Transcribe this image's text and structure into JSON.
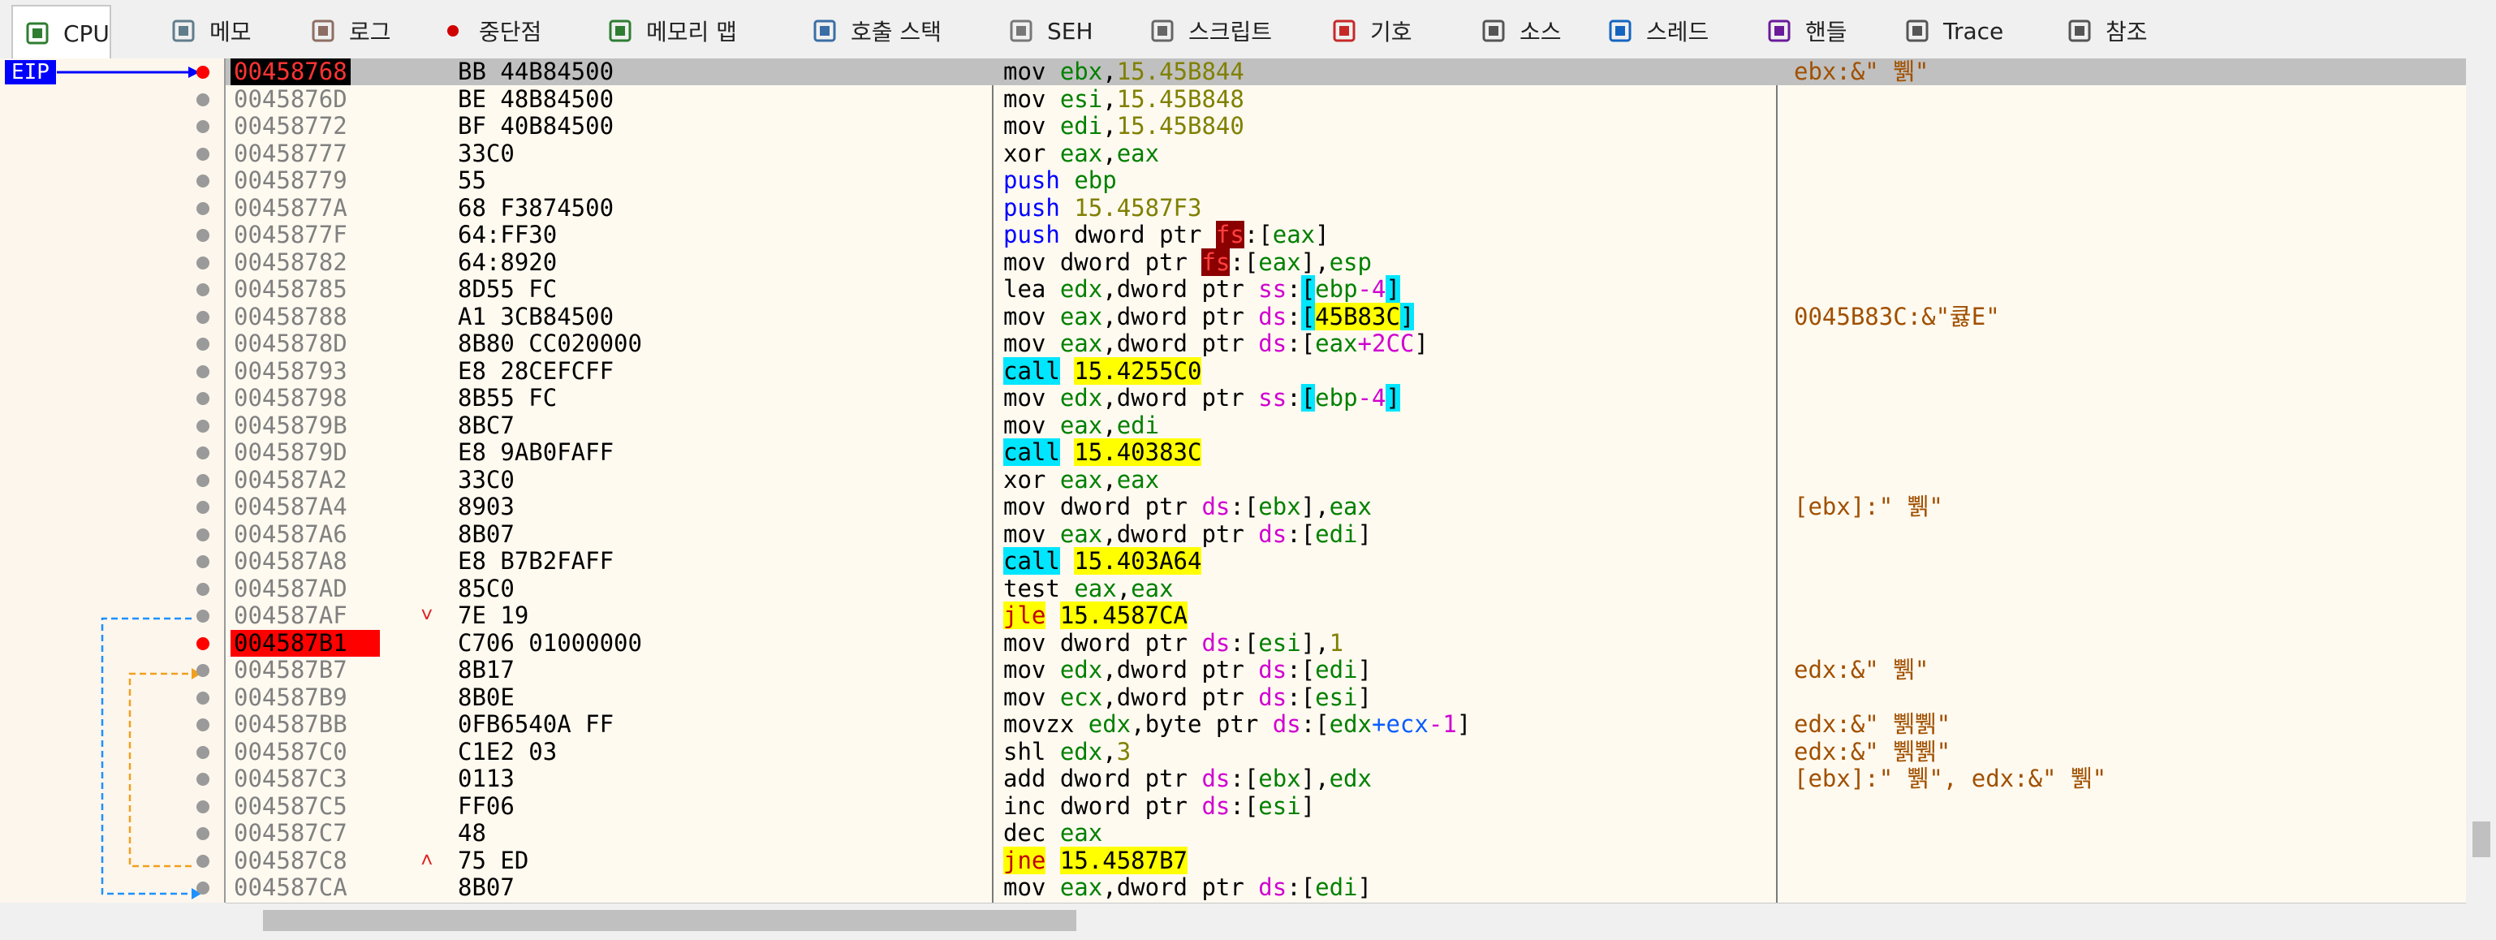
{
  "tabs": [
    {
      "label": "CPU",
      "icon": "cpu-icon",
      "active": true
    },
    {
      "label": "메모",
      "icon": "notes-icon"
    },
    {
      "label": "로그",
      "icon": "log-icon"
    },
    {
      "label": "중단점",
      "icon": "breakpoint-icon"
    },
    {
      "label": "메모리 맵",
      "icon": "memory-map-icon"
    },
    {
      "label": "호출 스택",
      "icon": "call-stack-icon"
    },
    {
      "label": "SEH",
      "icon": "seh-icon"
    },
    {
      "label": "스크립트",
      "icon": "script-icon"
    },
    {
      "label": "기호",
      "icon": "symbols-icon"
    },
    {
      "label": "소스",
      "icon": "source-icon"
    },
    {
      "label": "스레드",
      "icon": "threads-icon"
    },
    {
      "label": "핸들",
      "icon": "handles-icon"
    },
    {
      "label": "Trace",
      "icon": "trace-icon"
    },
    {
      "label": "참조",
      "icon": "references-icon"
    }
  ],
  "eip_label": "EIP",
  "rows": [
    {
      "addr": "00458768",
      "bytes": "BB 44B84500",
      "dis": [
        [
          "mn",
          "mov "
        ],
        [
          "reg",
          "ebx"
        ],
        [
          "",
          ","
        ],
        [
          "num",
          "15.45B844"
        ]
      ],
      "cmt": "ebx:&\" 쀍\"",
      "state": "eip"
    },
    {
      "addr": "0045876D",
      "bytes": "BE 48B84500",
      "dis": [
        [
          "mn",
          "mov "
        ],
        [
          "reg",
          "esi"
        ],
        [
          "",
          ","
        ],
        [
          "num",
          "15.45B848"
        ]
      ],
      "cmt": ""
    },
    {
      "addr": "00458772",
      "bytes": "BF 40B84500",
      "dis": [
        [
          "mn",
          "mov "
        ],
        [
          "reg",
          "edi"
        ],
        [
          "",
          ","
        ],
        [
          "num",
          "15.45B840"
        ]
      ],
      "cmt": ""
    },
    {
      "addr": "00458777",
      "bytes": "33C0",
      "dis": [
        [
          "mn",
          "xor "
        ],
        [
          "reg",
          "eax"
        ],
        [
          "",
          ","
        ],
        [
          "reg",
          "eax"
        ]
      ],
      "cmt": ""
    },
    {
      "addr": "00458779",
      "bytes": "55",
      "dis": [
        [
          "push",
          "push "
        ],
        [
          "reg",
          "ebp"
        ]
      ],
      "cmt": ""
    },
    {
      "addr": "0045877A",
      "bytes": "68 F3874500",
      "dis": [
        [
          "push",
          "push "
        ],
        [
          "num",
          "15.4587F3"
        ]
      ],
      "cmt": ""
    },
    {
      "addr": "0045877F",
      "bytes": "64:FF30",
      "dis": [
        [
          "push",
          "push "
        ],
        [
          "mn",
          "dword ptr "
        ],
        [
          "fs",
          "fs"
        ],
        [
          "",
          ":["
        ],
        [
          "reg",
          "eax"
        ],
        [
          "",
          "]"
        ]
      ],
      "cmt": ""
    },
    {
      "addr": "00458782",
      "bytes": "64:8920",
      "dis": [
        [
          "mn",
          "mov dword ptr "
        ],
        [
          "fs",
          "fs"
        ],
        [
          "",
          ":["
        ],
        [
          "reg",
          "eax"
        ],
        [
          "",
          "],"
        ],
        [
          "reg",
          "esp"
        ]
      ],
      "cmt": ""
    },
    {
      "addr": "00458785",
      "bytes": "8D55 FC",
      "dis": [
        [
          "mn",
          "lea "
        ],
        [
          "reg",
          "edx"
        ],
        [
          "",
          ",dword ptr "
        ],
        [
          "seg",
          "ss"
        ],
        [
          "",
          ":"
        ],
        [
          "brk",
          "["
        ],
        [
          "reg",
          "ebp"
        ],
        [
          "seg",
          "-4"
        ],
        [
          "brk",
          "]"
        ]
      ],
      "cmt": ""
    },
    {
      "addr": "00458788",
      "bytes": "A1 3CB84500",
      "dis": [
        [
          "mn",
          "mov "
        ],
        [
          "reg",
          "eax"
        ],
        [
          "",
          ",dword ptr "
        ],
        [
          "seg",
          "ds"
        ],
        [
          "",
          ":"
        ],
        [
          "brk",
          "["
        ],
        [
          "tgt",
          "45B83C"
        ],
        [
          "brk",
          "]"
        ]
      ],
      "cmt": "0045B83C:&\"큟E\""
    },
    {
      "addr": "0045878D",
      "bytes": "8B80 CC020000",
      "dis": [
        [
          "mn",
          "mov "
        ],
        [
          "reg",
          "eax"
        ],
        [
          "",
          ",dword ptr "
        ],
        [
          "seg",
          "ds"
        ],
        [
          "",
          ":["
        ],
        [
          "reg",
          "eax"
        ],
        [
          "seg",
          "+2CC"
        ],
        [
          "",
          "]"
        ]
      ],
      "cmt": ""
    },
    {
      "addr": "00458793",
      "bytes": "E8 28CEFCFF",
      "dis": [
        [
          "call",
          "call"
        ],
        [
          "",
          " "
        ],
        [
          "tgt",
          "15.4255C0"
        ]
      ],
      "cmt": ""
    },
    {
      "addr": "00458798",
      "bytes": "8B55 FC",
      "dis": [
        [
          "mn",
          "mov "
        ],
        [
          "reg",
          "edx"
        ],
        [
          "",
          ",dword ptr "
        ],
        [
          "seg",
          "ss"
        ],
        [
          "",
          ":"
        ],
        [
          "brk",
          "["
        ],
        [
          "reg",
          "ebp"
        ],
        [
          "seg",
          "-4"
        ],
        [
          "brk",
          "]"
        ]
      ],
      "cmt": ""
    },
    {
      "addr": "0045879B",
      "bytes": "8BC7",
      "dis": [
        [
          "mn",
          "mov "
        ],
        [
          "reg",
          "eax"
        ],
        [
          "",
          ","
        ],
        [
          "reg",
          "edi"
        ]
      ],
      "cmt": ""
    },
    {
      "addr": "0045879D",
      "bytes": "E8 9AB0FAFF",
      "dis": [
        [
          "call",
          "call"
        ],
        [
          "",
          " "
        ],
        [
          "tgt",
          "15.40383C"
        ]
      ],
      "cmt": ""
    },
    {
      "addr": "004587A2",
      "bytes": "33C0",
      "dis": [
        [
          "mn",
          "xor "
        ],
        [
          "reg",
          "eax"
        ],
        [
          "",
          ","
        ],
        [
          "reg",
          "eax"
        ]
      ],
      "cmt": ""
    },
    {
      "addr": "004587A4",
      "bytes": "8903",
      "dis": [
        [
          "mn",
          "mov dword ptr "
        ],
        [
          "seg",
          "ds"
        ],
        [
          "",
          ":["
        ],
        [
          "reg",
          "ebx"
        ],
        [
          "",
          "],"
        ],
        [
          "reg",
          "eax"
        ]
      ],
      "cmt": "[ebx]:\" 쀍\""
    },
    {
      "addr": "004587A6",
      "bytes": "8B07",
      "dis": [
        [
          "mn",
          "mov "
        ],
        [
          "reg",
          "eax"
        ],
        [
          "",
          ",dword ptr "
        ],
        [
          "seg",
          "ds"
        ],
        [
          "",
          ":["
        ],
        [
          "reg",
          "edi"
        ],
        [
          "",
          "]"
        ]
      ],
      "cmt": ""
    },
    {
      "addr": "004587A8",
      "bytes": "E8 B7B2FAFF",
      "dis": [
        [
          "call",
          "call"
        ],
        [
          "",
          " "
        ],
        [
          "tgt",
          "15.403A64"
        ]
      ],
      "cmt": ""
    },
    {
      "addr": "004587AD",
      "bytes": "85C0",
      "dis": [
        [
          "mn",
          "test "
        ],
        [
          "reg",
          "eax"
        ],
        [
          "",
          ","
        ],
        [
          "reg",
          "eax"
        ]
      ],
      "cmt": ""
    },
    {
      "addr": "004587AF",
      "bytes": "7E 19",
      "arrow": "˅",
      "dis": [
        [
          "jmp",
          "jle"
        ],
        [
          "",
          " "
        ],
        [
          "tgt",
          "15.4587CA"
        ]
      ],
      "cmt": ""
    },
    {
      "addr": "004587B1",
      "bytes": "C706 01000000",
      "dis": [
        [
          "mn",
          "mov dword ptr "
        ],
        [
          "seg",
          "ds"
        ],
        [
          "",
          ":["
        ],
        [
          "reg",
          "esi"
        ],
        [
          "",
          "],"
        ],
        [
          "num",
          "1"
        ]
      ],
      "cmt": "",
      "state": "bp"
    },
    {
      "addr": "004587B7",
      "bytes": "8B17",
      "dis": [
        [
          "mn",
          "mov "
        ],
        [
          "reg",
          "edx"
        ],
        [
          "",
          ",dword ptr "
        ],
        [
          "seg",
          "ds"
        ],
        [
          "",
          ":["
        ],
        [
          "reg",
          "edi"
        ],
        [
          "",
          "]"
        ]
      ],
      "cmt": "edx:&\" 쀍\""
    },
    {
      "addr": "004587B9",
      "bytes": "8B0E",
      "dis": [
        [
          "mn",
          "mov "
        ],
        [
          "reg",
          "ecx"
        ],
        [
          "",
          ",dword ptr "
        ],
        [
          "seg",
          "ds"
        ],
        [
          "",
          ":["
        ],
        [
          "reg",
          "esi"
        ],
        [
          "",
          "]"
        ]
      ],
      "cmt": ""
    },
    {
      "addr": "004587BB",
      "bytes": "0FB6540A FF",
      "dis": [
        [
          "mn",
          "movzx "
        ],
        [
          "reg",
          "edx"
        ],
        [
          "",
          ",byte ptr "
        ],
        [
          "seg",
          "ds"
        ],
        [
          "",
          ":["
        ],
        [
          "reg",
          "edx"
        ],
        [
          "reg2",
          "+ecx"
        ],
        [
          "seg",
          "-1"
        ],
        [
          "",
          "]"
        ]
      ],
      "cmt": "edx:&\" 쀍쀍\""
    },
    {
      "addr": "004587C0",
      "bytes": "C1E2 03",
      "dis": [
        [
          "mn",
          "shl "
        ],
        [
          "reg",
          "edx"
        ],
        [
          "",
          ","
        ],
        [
          "num",
          "3"
        ]
      ],
      "cmt": "edx:&\" 쀍쀍\""
    },
    {
      "addr": "004587C3",
      "bytes": "0113",
      "dis": [
        [
          "mn",
          "add dword ptr "
        ],
        [
          "seg",
          "ds"
        ],
        [
          "",
          ":["
        ],
        [
          "reg",
          "ebx"
        ],
        [
          "",
          "],"
        ],
        [
          "reg",
          "edx"
        ]
      ],
      "cmt": "[ebx]:\" 쀍\", edx:&\" 쀍\""
    },
    {
      "addr": "004587C5",
      "bytes": "FF06",
      "dis": [
        [
          "mn",
          "inc dword ptr "
        ],
        [
          "seg",
          "ds"
        ],
        [
          "",
          ":["
        ],
        [
          "reg",
          "esi"
        ],
        [
          "",
          "]"
        ]
      ],
      "cmt": ""
    },
    {
      "addr": "004587C7",
      "bytes": "48",
      "dis": [
        [
          "mn",
          "dec "
        ],
        [
          "reg",
          "eax"
        ]
      ],
      "cmt": ""
    },
    {
      "addr": "004587C8",
      "bytes": "75 ED",
      "arrow": "˄",
      "dis": [
        [
          "jmp",
          "jne"
        ],
        [
          "",
          " "
        ],
        [
          "tgt",
          "15.4587B7"
        ]
      ],
      "cmt": ""
    },
    {
      "addr": "004587CA",
      "bytes": "8B07",
      "dis": [
        [
          "mn",
          "mov "
        ],
        [
          "reg",
          "eax"
        ],
        [
          "",
          ",dword ptr "
        ],
        [
          "seg",
          "ds"
        ],
        [
          "",
          ":["
        ],
        [
          "reg",
          "edi"
        ],
        [
          "",
          "]"
        ]
      ],
      "cmt": ""
    }
  ]
}
